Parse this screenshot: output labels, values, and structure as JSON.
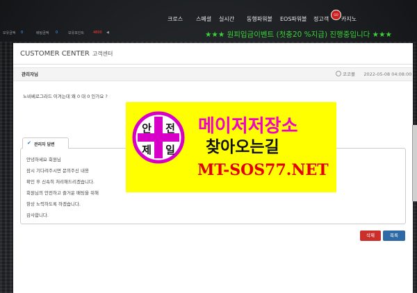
{
  "nav": {
    "items": [
      "크로스",
      "스페셜",
      "실시간",
      "동행파워볼",
      "EOS파워볼",
      "정고객",
      "카지노"
    ],
    "casino_badge": "GO"
  },
  "status": {
    "label1": "보유금액",
    "value1": "0",
    "label2": "배팅금액",
    "value2": "0",
    "label3": "보유포인트",
    "value3": "4800",
    "marquee": "★★★ 원피입금이벤트 (첫충20 %지급) 진행중입니다 ★★★"
  },
  "panel": {
    "title": "CUSTOMER CENTER",
    "subtitle": "고객센터",
    "author": "관리자님",
    "meta_user": "코코볼",
    "date": "2022-05-08 04:08:00",
    "question": "노비베로그라드 이겨는데 왜 0 대 0 인가요 ?"
  },
  "answer": {
    "tab_label": "관리자 답변",
    "lines": [
      "안녕하세요 회원님",
      "잠시 기다려주시면 문의주신 내용",
      "확인 후 신속히 처리해드리겠습니다.",
      "회원님의 안전하고 즐거운 배팅을 위해",
      "항상 노력하도록 하겠습니다.",
      "감사합니다."
    ]
  },
  "buttons": {
    "delete": "삭제",
    "list": "목록"
  },
  "ad": {
    "logo_chars": [
      "안",
      "전",
      "제",
      "일"
    ],
    "line1": "메이저저장소",
    "line2": "찾아오는길",
    "line3": "MT-SOS77.NET",
    "colors": {
      "background": "#ffff00",
      "magenta": "#f000c8",
      "red": "#e40000"
    }
  }
}
